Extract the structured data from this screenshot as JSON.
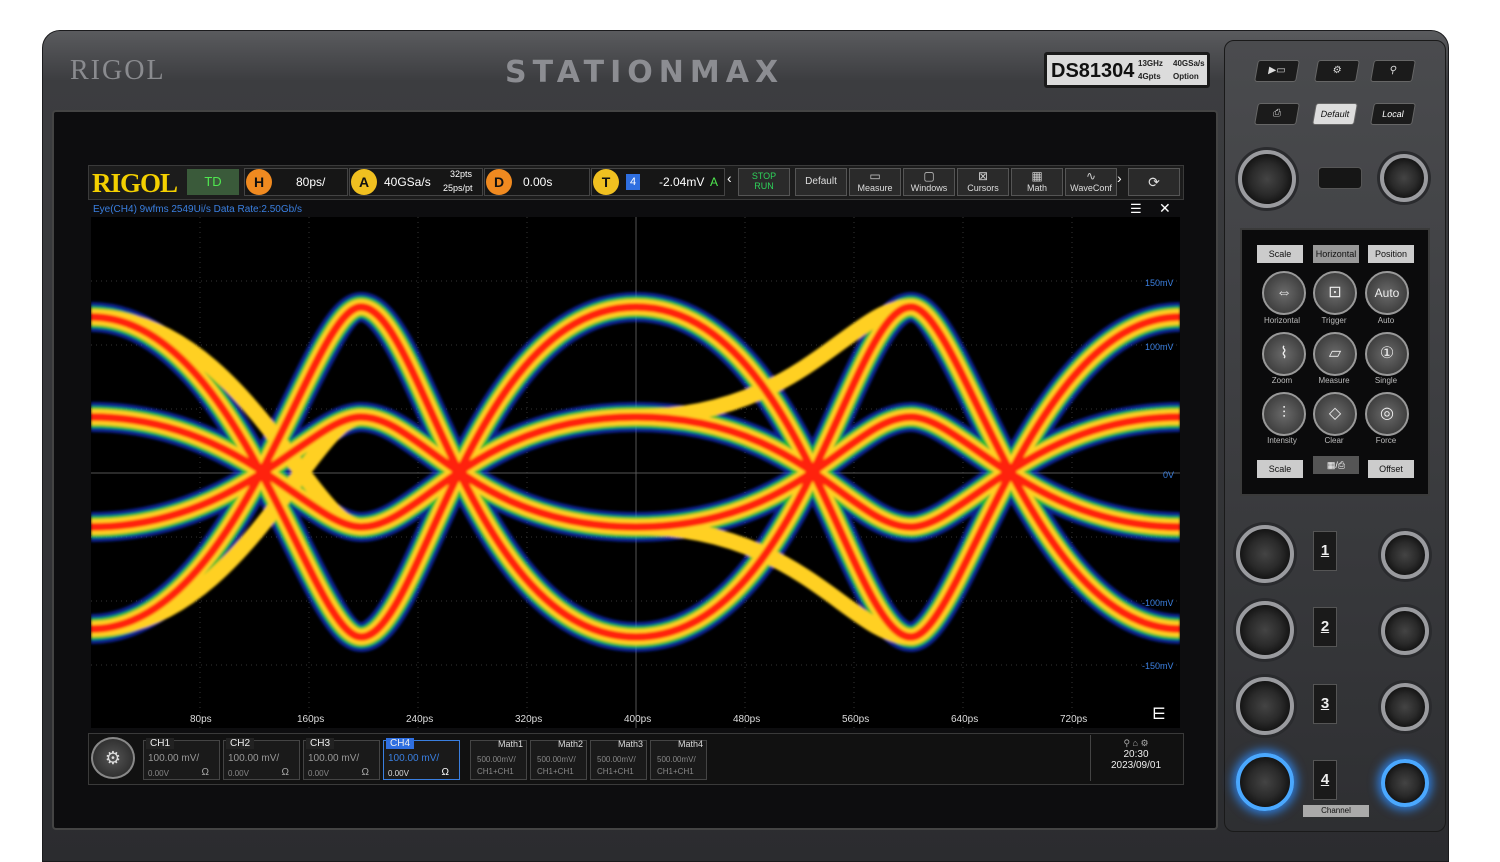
{
  "device": {
    "brand": "RIGOL",
    "series_logo": "STATIONMAX",
    "model": "DS81304",
    "model_spec_1": "13GHz",
    "model_spec_2": "40GSa/s",
    "model_spec_3": "4Gpts",
    "model_spec_4": "Option"
  },
  "topbar": {
    "logo": "RIGOL",
    "mode": "TD",
    "h_letter": "H",
    "h_value": "80ps/",
    "a_letter": "A",
    "a_value": "40GSa/s",
    "a_pts": "32pts",
    "a_ppt": "25ps/pt",
    "d_letter": "D",
    "d_value": "0.00s",
    "t_letter": "T",
    "t_channel": "4",
    "t_value": "-2.04mV",
    "t_slope": "A",
    "buttons": {
      "stop_run_1": "STOP",
      "stop_run_2": "RUN",
      "default": "Default",
      "measure": "Measure",
      "windows": "Windows",
      "cursors": "Cursors",
      "math": "Math",
      "waveconf": "WaveConf"
    }
  },
  "plot": {
    "info": "Eye(CH4)   9wfms   2549Ui/s   Data Rate:2.50Gb/s",
    "y_labels": [
      "150mV",
      "100mV",
      "0V",
      "-100mV",
      "-150mV"
    ],
    "x_labels": [
      "80ps",
      "160ps",
      "240ps",
      "320ps",
      "400ps",
      "480ps",
      "560ps",
      "640ps",
      "720ps"
    ]
  },
  "channels": [
    {
      "name": "CH1",
      "scale": "100.00 mV/",
      "offset": "0.00V",
      "imp": "Ω",
      "color": "#f0d000"
    },
    {
      "name": "CH2",
      "scale": "100.00 mV/",
      "offset": "0.00V",
      "imp": "Ω",
      "color": "#32c8ff"
    },
    {
      "name": "CH3",
      "scale": "100.00 mV/",
      "offset": "0.00V",
      "imp": "Ω",
      "color": "#e040e0"
    },
    {
      "name": "CH4",
      "scale": "100.00 mV/",
      "offset": "0.00V",
      "imp": "Ω",
      "color": "#3a7fe0"
    }
  ],
  "math": [
    {
      "name": "Math1",
      "scale": "500.00mV/",
      "expr": "CH1+CH1"
    },
    {
      "name": "Math2",
      "scale": "500.00mV/",
      "expr": "CH1+CH1"
    },
    {
      "name": "Math3",
      "scale": "500.00mV/",
      "expr": "CH1+CH1"
    },
    {
      "name": "Math4",
      "scale": "500.00mV/",
      "expr": "CH1+CH1"
    }
  ],
  "clock": {
    "time": "20:30",
    "date": "2023/09/01"
  },
  "panel": {
    "default": "Default",
    "local": "Local",
    "tab_scale": "Scale",
    "tab_horizontal": "Horizontal",
    "tab_position": "Position",
    "keys": [
      "Horizontal",
      "Trigger",
      "Auto",
      "Zoom",
      "Measure",
      "Single",
      "Intensity",
      "Clear",
      "Force"
    ],
    "scale2": "Scale",
    "offset": "Offset",
    "channel_label": "Channel",
    "channel_numbers": [
      "1",
      "2",
      "3",
      "4"
    ]
  }
}
